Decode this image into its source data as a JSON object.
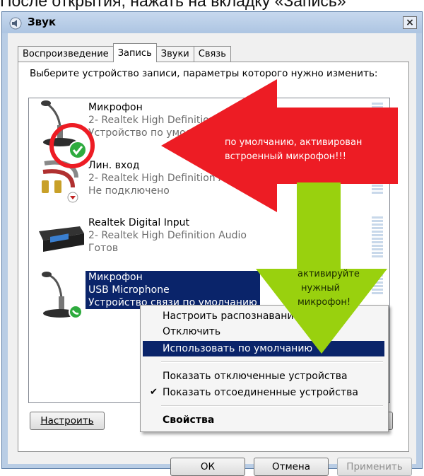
{
  "caption": "После открытия, нажать на вкладку «Запись»",
  "window": {
    "title": "Звук",
    "close_glyph": "×"
  },
  "tabs": [
    {
      "label": "Воспроизведение",
      "active": false
    },
    {
      "label": "Запись",
      "active": true
    },
    {
      "label": "Звуки",
      "active": false
    },
    {
      "label": "Связь",
      "active": false
    }
  ],
  "instruction": "Выберите устройство записи, параметры которого нужно изменить:",
  "devices": [
    {
      "name": "Микрофон",
      "line2": "2- Realtek High Definition Audio",
      "line3": "Устройство по умолчанию",
      "icon": "microphone-icon",
      "status": "default-check"
    },
    {
      "name": "Лин. вход",
      "line2": "2- Realtek High Definition Audio",
      "line3": "Не подключено",
      "icon": "line-in-icon",
      "status": "unplugged"
    },
    {
      "name": "Realtek Digital Input",
      "line2": "2- Realtek High Definition Audio",
      "line3": "Готов",
      "icon": "digital-input-icon",
      "status": "ready"
    },
    {
      "name": "Микрофон",
      "line2": "USB Microphone",
      "line3": "Устройство связи по умолчанию",
      "icon": "usb-microphone-icon",
      "status": "default-comm"
    }
  ],
  "context_menu": {
    "items": [
      "Настроить распознавание речи",
      "Отключить",
      "Использовать по умолчанию",
      "Показать отключенные устройства",
      "Показать отсоединенные устройства",
      "Свойства"
    ],
    "checked_item": "Показать отсоединенные устройства",
    "highlighted_item": "Использовать по умолчанию"
  },
  "buttons": {
    "configure": "Настроить",
    "ok": "ОК",
    "cancel": "Отмена",
    "apply": "Применить"
  },
  "annotations": {
    "red_arrow_line1": "по умолчанию, активирован",
    "red_arrow_line2": "встроенный микрофон!!!",
    "green_arrow_line1": "активируйте",
    "green_arrow_line2": "нужный",
    "green_arrow_line3": "микрофон!"
  },
  "colors": {
    "selection": "#0a246a",
    "red_arrow": "#ed1c24",
    "green_arrow": "#99d10e",
    "check_green": "#2eab3e"
  }
}
